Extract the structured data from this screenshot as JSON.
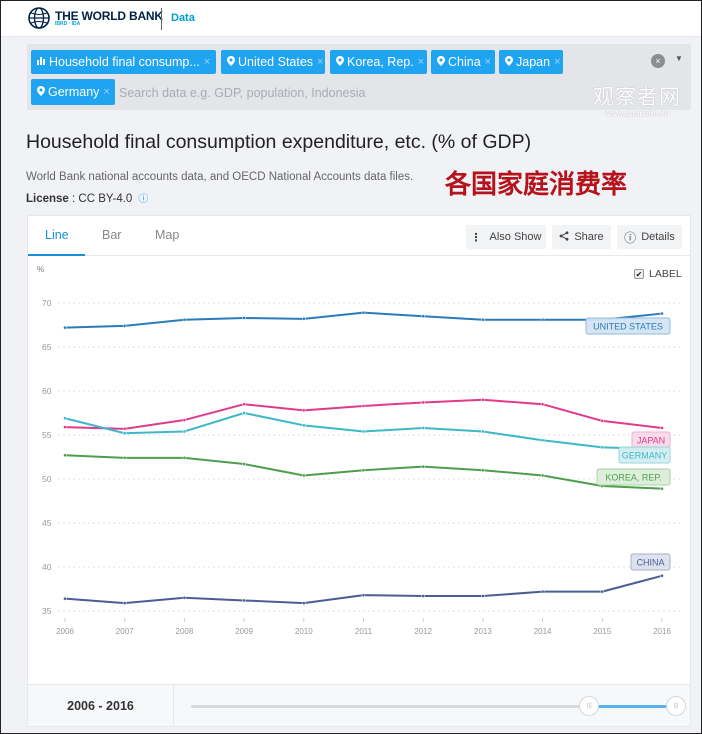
{
  "header": {
    "brand_main": "THE WORLD BANK",
    "brand_sub": "IBRD · IDA",
    "section_link": "Data"
  },
  "search": {
    "chips": [
      {
        "icon": "bar-chart-icon",
        "glyph": "▐",
        "label": "Household final consump...",
        "remove": "×"
      },
      {
        "icon": "location-pin-icon",
        "glyph": "●",
        "label": "United States",
        "remove": "×"
      },
      {
        "icon": "location-pin-icon",
        "glyph": "●",
        "label": "Korea, Rep.",
        "remove": "×"
      },
      {
        "icon": "location-pin-icon",
        "glyph": "●",
        "label": "China",
        "remove": "×"
      },
      {
        "icon": "location-pin-icon",
        "glyph": "●",
        "label": "Japan",
        "remove": "×"
      },
      {
        "icon": "location-pin-icon",
        "glyph": "●",
        "label": "Germany",
        "remove": "×"
      }
    ],
    "placeholder": "Search data e.g. GDP, population, Indonesia",
    "value": "",
    "clear_glyph": "×",
    "dropdown_glyph": "▼"
  },
  "watermark": {
    "line1": "观察者网",
    "line2": "www.guancha.cn"
  },
  "page": {
    "title": "Household final consumption expenditure, etc. (% of GDP)",
    "source": "World Bank national accounts data, and OECD National Accounts data files.",
    "license_label": "License",
    "license_value": " : CC BY-4.0",
    "info_glyph": "ⓘ",
    "overlay_title": "各国家庭消费率"
  },
  "tabs": [
    {
      "label": "Line",
      "active": true
    },
    {
      "label": "Bar",
      "active": false
    },
    {
      "label": "Map",
      "active": false
    }
  ],
  "toolbar": {
    "also_show": "Also Show",
    "also_show_glyph": "⋮",
    "share": "Share",
    "share_glyph": "<",
    "details": "Details",
    "details_glyph": "ⓘ"
  },
  "label_toggle": {
    "label": "LABEL",
    "checked": true,
    "glyph": "✔"
  },
  "range": {
    "label": "2006 - 2016",
    "min_year": 1960,
    "max_year": 2016,
    "start": 2006,
    "end": 2016
  },
  "chart_data": {
    "type": "line",
    "title": "Household final consumption expenditure, etc. (% of GDP)",
    "ylabel": "%",
    "xlabel": "",
    "x": [
      2006,
      2007,
      2008,
      2009,
      2010,
      2011,
      2012,
      2013,
      2014,
      2015,
      2016
    ],
    "ylim": [
      34,
      71
    ],
    "yticks": [
      35,
      40,
      45,
      50,
      55,
      60,
      65,
      70
    ],
    "grid": true,
    "legend": "inline-end-labels",
    "series": [
      {
        "name": "UNITED STATES",
        "color": "#2b7bb9",
        "label_bg": "#d3e4f3",
        "label_border": "#8fb8dc",
        "values": [
          67.2,
          67.4,
          68.1,
          68.3,
          68.2,
          68.9,
          68.5,
          68.1,
          68.1,
          68.1,
          68.8
        ]
      },
      {
        "name": "JAPAN",
        "color": "#e03a8a",
        "label_bg": "#f9dbe9",
        "label_border": "#eeabc9",
        "values": [
          55.9,
          55.7,
          56.7,
          58.5,
          57.8,
          58.3,
          58.7,
          59.0,
          58.5,
          56.6,
          55.8
        ]
      },
      {
        "name": "GERMANY",
        "color": "#3db8c8",
        "label_bg": "#d2eef2",
        "label_border": "#93d3dc",
        "values": [
          56.9,
          55.2,
          55.4,
          57.5,
          56.1,
          55.4,
          55.8,
          55.4,
          54.4,
          53.6,
          53.4
        ]
      },
      {
        "name": "KOREA, REP.",
        "color": "#4e9e4e",
        "label_bg": "#dcefd9",
        "label_border": "#a6d19f",
        "values": [
          52.7,
          52.4,
          52.4,
          51.7,
          50.4,
          51.0,
          51.4,
          51.0,
          50.4,
          49.2,
          48.9
        ]
      },
      {
        "name": "CHINA",
        "color": "#4a5e94",
        "label_bg": "#dde1ee",
        "label_border": "#a4acc9",
        "values": [
          36.4,
          35.9,
          36.5,
          36.2,
          35.9,
          36.8,
          36.7,
          36.7,
          37.2,
          37.2,
          39.0
        ]
      }
    ]
  }
}
